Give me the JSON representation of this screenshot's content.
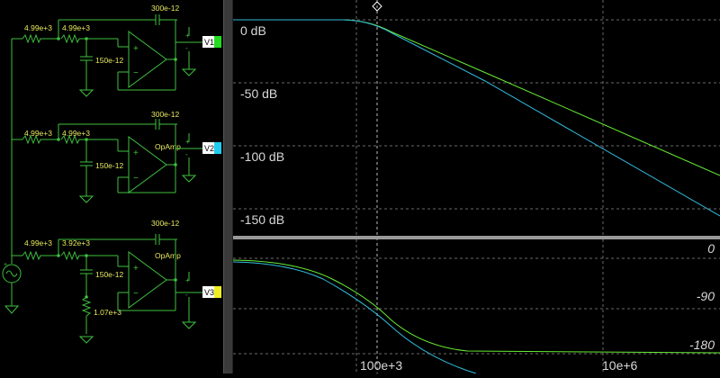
{
  "schematic": {
    "stages": [
      {
        "r1": "4.99e+3",
        "r2": "4.99e+3",
        "c_fb": "300e-12",
        "c_gnd": "150e-12",
        "opamp": "",
        "probe": "V1",
        "probe_color": "#22dd22"
      },
      {
        "r1": "4.99e+3",
        "r2": "4.99e+3",
        "c_fb": "300e-12",
        "c_gnd": "150e-12",
        "opamp": "OpAmp",
        "probe": "V2",
        "probe_color": "#22ccee"
      },
      {
        "r1": "4.99e+3",
        "r2": "3.92e+3",
        "c_fb": "300e-12",
        "c_gnd": "150e-12",
        "opamp": "OpAmp",
        "r_gnd": "1.07e+3",
        "probe": "V3",
        "probe_color": "#eeee22"
      }
    ],
    "wire_color": "#3fbf3f",
    "label_color": "#e8e860"
  },
  "plots": {
    "magnitude": {
      "labels": [
        "0 dB",
        "-50 dB",
        "-100 dB",
        "-150 dB"
      ]
    },
    "phase": {
      "labels": [
        "0",
        "-90",
        "-180"
      ]
    },
    "x_axis": {
      "labels": [
        "100e+3",
        "10e+6"
      ]
    },
    "series_colors": {
      "V1": "#66ee33",
      "V2": "#33bbdd"
    }
  }
}
